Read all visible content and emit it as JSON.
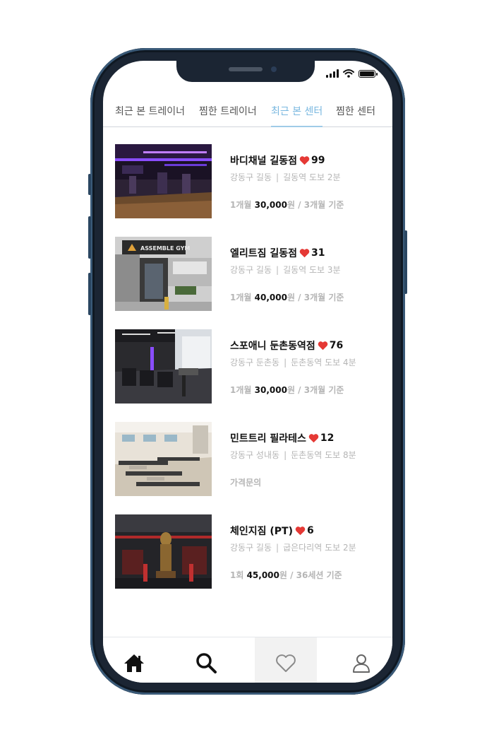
{
  "tabs": [
    {
      "label": "최근 본 트레이너",
      "active": false
    },
    {
      "label": "찜한 트레이너",
      "active": false
    },
    {
      "label": "최근 본 센터",
      "active": true
    },
    {
      "label": "찜한 센터",
      "active": false
    }
  ],
  "centers": [
    {
      "name": "바디채널 길동점",
      "likes": "99",
      "area": "강동구 길동",
      "station": "길동역 도보 2분",
      "price_prefix": "1개월",
      "price_amount": "30,000",
      "price_suffix": "원 / 3개월 기준"
    },
    {
      "name": "엘리트짐 길동점",
      "likes": "31",
      "area": "강동구 길동",
      "station": "길동역 도보 3분",
      "price_prefix": "1개월",
      "price_amount": "40,000",
      "price_suffix": "원 / 3개월 기준",
      "sign_text": "ASSEMBLE GYM"
    },
    {
      "name": "스포애니 둔촌동역점",
      "likes": "76",
      "area": "강동구 둔촌동",
      "station": "둔촌동역 도보 4분",
      "price_prefix": "1개월",
      "price_amount": "30,000",
      "price_suffix": "원 / 3개월 기준"
    },
    {
      "name": "민트트리 필라테스",
      "likes": "12",
      "area": "강동구 성내동",
      "station": "둔촌동역 도보 8분",
      "price_prefix": "가격문의",
      "price_amount": "",
      "price_suffix": ""
    },
    {
      "name": "체인지짐 (PT)",
      "likes": "6",
      "area": "강동구 길동",
      "station": "굽은다리역 도보 2분",
      "price_prefix": "1회",
      "price_amount": "45,000",
      "price_suffix": "원 / 36세션 기준"
    }
  ],
  "bottom_nav": [
    {
      "icon": "home-icon",
      "active": false
    },
    {
      "icon": "search-icon",
      "active": false
    },
    {
      "icon": "heart-outline-icon",
      "active": true
    },
    {
      "icon": "user-icon",
      "active": false
    }
  ],
  "colors": {
    "active_tab": "#7ab8e0",
    "heart": "#e53935",
    "muted_text": "#b5b5b5",
    "phone_frame": "#1b2533"
  }
}
